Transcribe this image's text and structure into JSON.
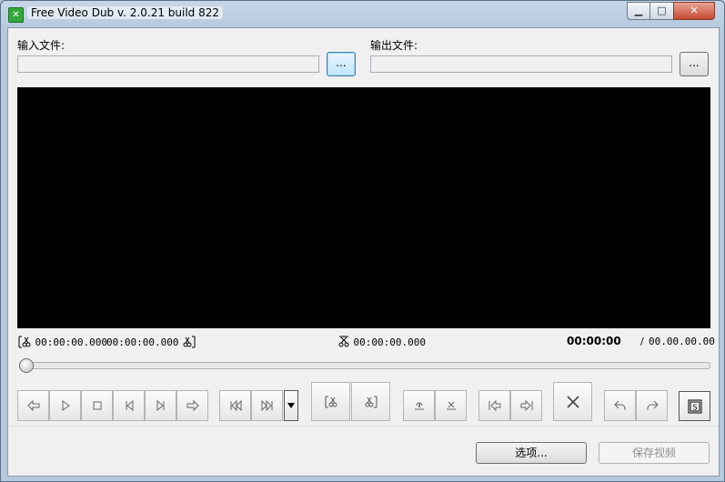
{
  "window": {
    "title": "Free Video Dub  v. 2.0.21 build 822",
    "minimize": "▁",
    "maximize": "□",
    "close": "✕",
    "app_icon_glyph": "✕"
  },
  "input": {
    "label": "输入文件:",
    "value": "",
    "browse_label": "..."
  },
  "output": {
    "label": "输出文件:",
    "value": "",
    "browse_label": "..."
  },
  "timeline": {
    "selection_start": "00:00:00.000",
    "selection_end": "00:00:00.000",
    "cut_time": "00:00:00.000",
    "current_time": "00:00:00",
    "total_separator": "/",
    "total_time": "00.00.00.00",
    "slider_position": 0
  },
  "toolbar_icons": [
    "step-back-icon",
    "play-icon",
    "stop-icon",
    "prev-frame-icon",
    "next-frame-icon",
    "step-forward-icon",
    "prev-keyframe-icon",
    "next-keyframe-icon",
    "dropdown-arrow-icon",
    "mark-start-icon",
    "mark-end-icon",
    "audio-icon",
    "cut-out-icon",
    "go-to-start-icon",
    "go-to-end-icon",
    "delete-icon",
    "undo-icon",
    "redo-icon",
    "snapshot-icon"
  ],
  "footer": {
    "options_label": "选项...",
    "save_label": "保存视频"
  },
  "colors": {
    "video_bg": "#000000",
    "client_bg": "#f0f0f0",
    "close_button": "#c64a32"
  }
}
